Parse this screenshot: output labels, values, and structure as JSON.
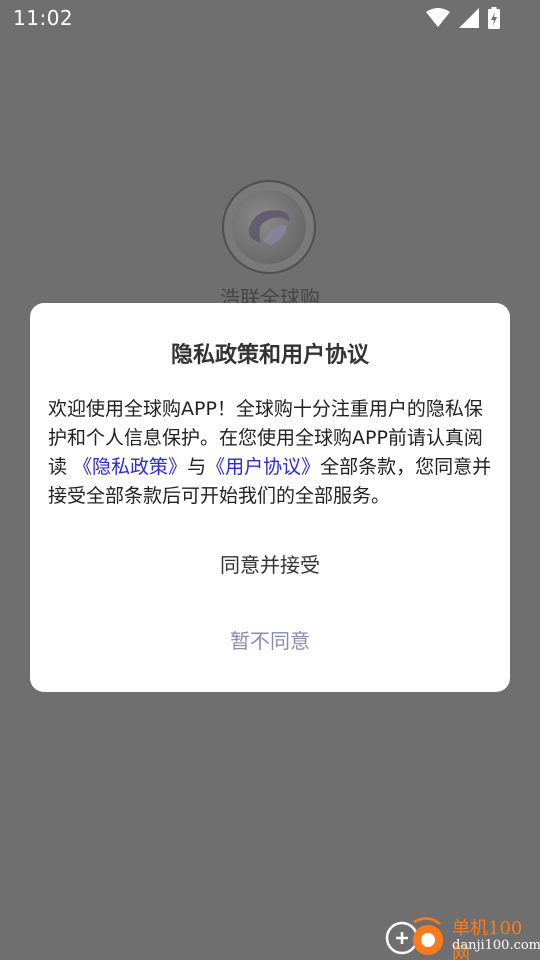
{
  "status_bar": {
    "time": "11:02",
    "icons": [
      "wifi-icon",
      "signal-icon",
      "battery-charging-icon"
    ]
  },
  "background_app": {
    "name": "浩联全球购"
  },
  "dialog": {
    "title": "隐私政策和用户协议",
    "body_part1": "欢迎使用全球购APP！全球购十分注重用户的隐私保护和个人信息保护。在您使用全球购APP前请认真阅读 ",
    "privacy_link": "《隐私政策》",
    "body_part2": "与",
    "agreement_link": "《用户协议》",
    "body_part3": "全部条款，您同意并接受全部条款后可开始我们的全部服务。",
    "accept_label": "同意并接受",
    "decline_label": "暂不同意"
  },
  "watermark": {
    "cn": "单机100网",
    "en": "danji100.com"
  },
  "colors": {
    "overlay": "#6f6f6f",
    "link": "#2a2ad6",
    "decline": "#8d8ab7",
    "watermark_accent": "#ff7a1a"
  }
}
